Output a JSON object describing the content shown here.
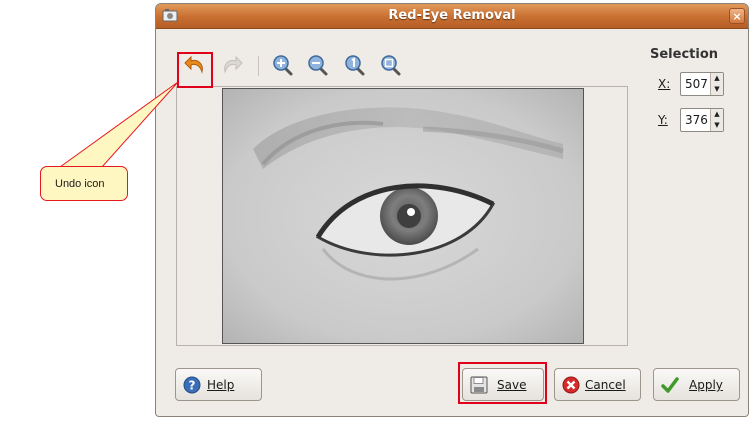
{
  "window": {
    "title": "Red-Eye Removal",
    "close_glyph": "×"
  },
  "toolbar": {
    "icons": [
      "undo-icon",
      "redo-icon",
      "zoom-in-icon",
      "zoom-out-icon",
      "zoom-100-icon",
      "zoom-fit-icon"
    ]
  },
  "selection": {
    "title": "Selection",
    "x_label": "X:",
    "x_value": "507",
    "y_label": "Y:",
    "y_value": "376"
  },
  "buttons": {
    "help": "Help",
    "save": "Save",
    "cancel": "Cancel",
    "apply": "Apply"
  },
  "annotation": {
    "callout_text": "Undo icon"
  },
  "colors": {
    "titlebar": "#c86e31",
    "highlight": "#e0001a",
    "callout_bg": "#fff7c2"
  }
}
